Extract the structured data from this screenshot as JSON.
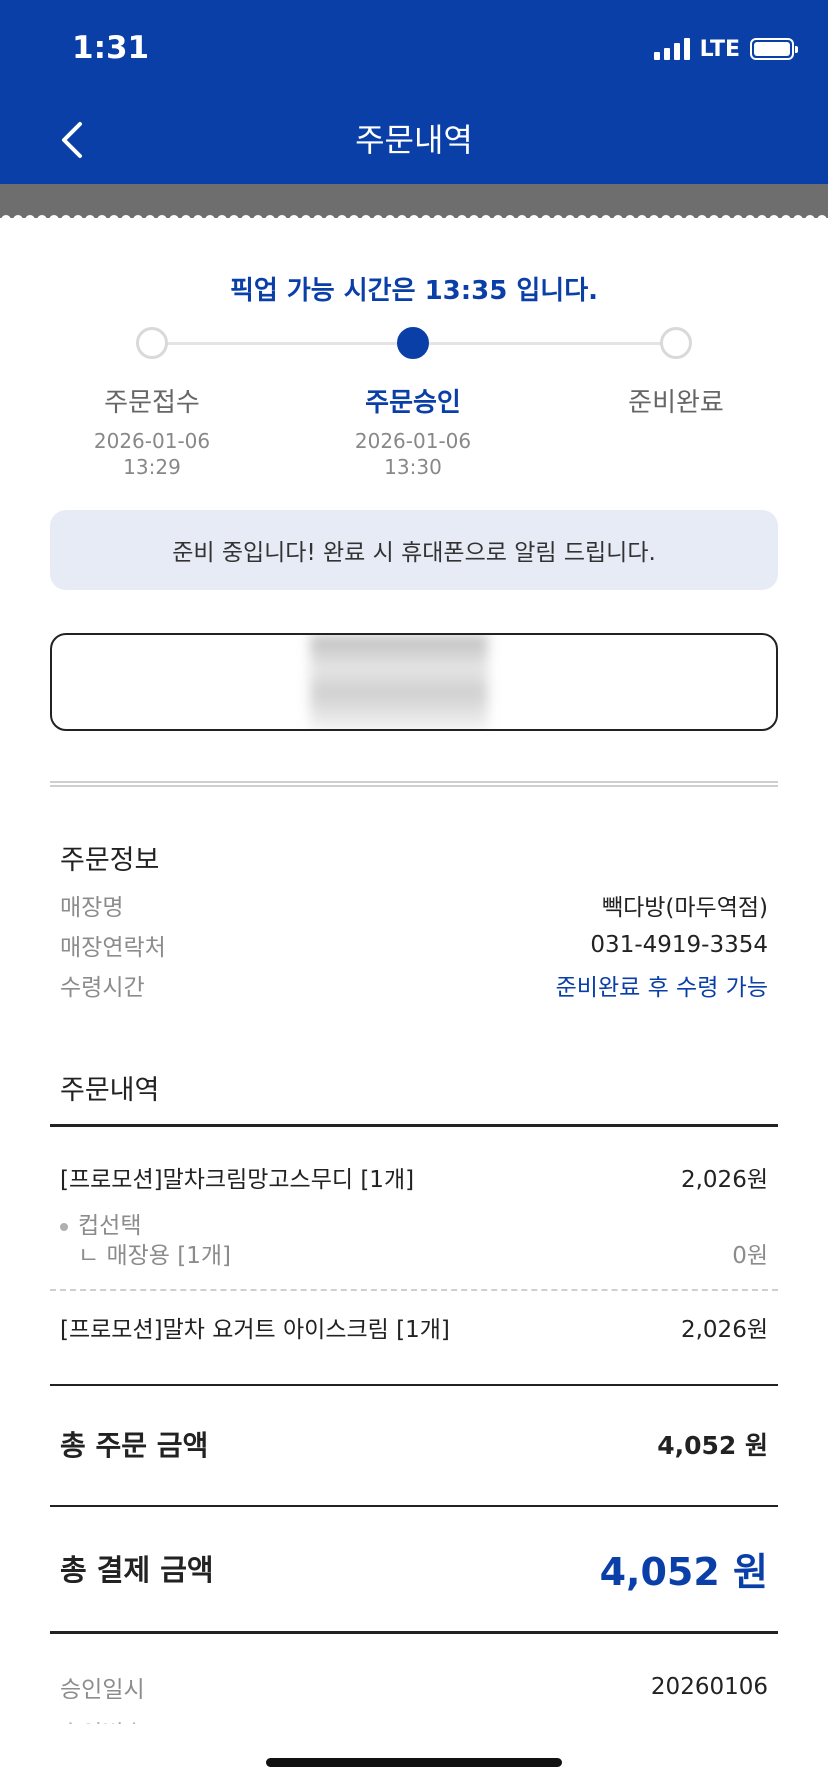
{
  "status_bar": {
    "time": "1:31",
    "network": "LTE"
  },
  "header": {
    "title": "주문내역",
    "back_icon": "chevron-left-icon"
  },
  "pickup_message": "픽업 가능 시간은 13:35 입니다.",
  "steps": [
    {
      "label": "주문접수",
      "date": "2026-01-06",
      "time": "13:29",
      "state": "done"
    },
    {
      "label": "주문승인",
      "date": "2026-01-06",
      "time": "13:30",
      "state": "active"
    },
    {
      "label": "준비완료",
      "date": "",
      "time": "",
      "state": "pending"
    }
  ],
  "notice": "준비 중입니다! 완료 시 휴대폰으로 알림 드립니다.",
  "order_info": {
    "title": "주문정보",
    "rows": [
      {
        "label": "매장명",
        "value": "빽다방(마두역점)"
      },
      {
        "label": "매장연락처",
        "value": "031-4919-3354"
      },
      {
        "label": "수령시간",
        "value": "준비완료 후 수령 가능"
      }
    ]
  },
  "order_details": {
    "title": "주문내역",
    "items": [
      {
        "name": "[프로모션]말차크림망고스무디 [1개]",
        "price": "2,026원",
        "option_group": "컵선택",
        "option": {
          "name": "ㄴ 매장용 [1개]",
          "price": "0원"
        }
      },
      {
        "name": "[프로모션]말차 요거트 아이스크림 [1개]",
        "price": "2,026원"
      }
    ]
  },
  "totals": {
    "order_label": "총 주문 금액",
    "order_value": "4,052 원",
    "pay_label": "총 결제 금액",
    "pay_value": "4,052 원"
  },
  "approval": {
    "date_label": "승인일시",
    "date_value": "20260106",
    "number_label": "승인번호"
  },
  "colors": {
    "brand": "#0a3fa8",
    "notice_bg": "#e6ebf5"
  }
}
